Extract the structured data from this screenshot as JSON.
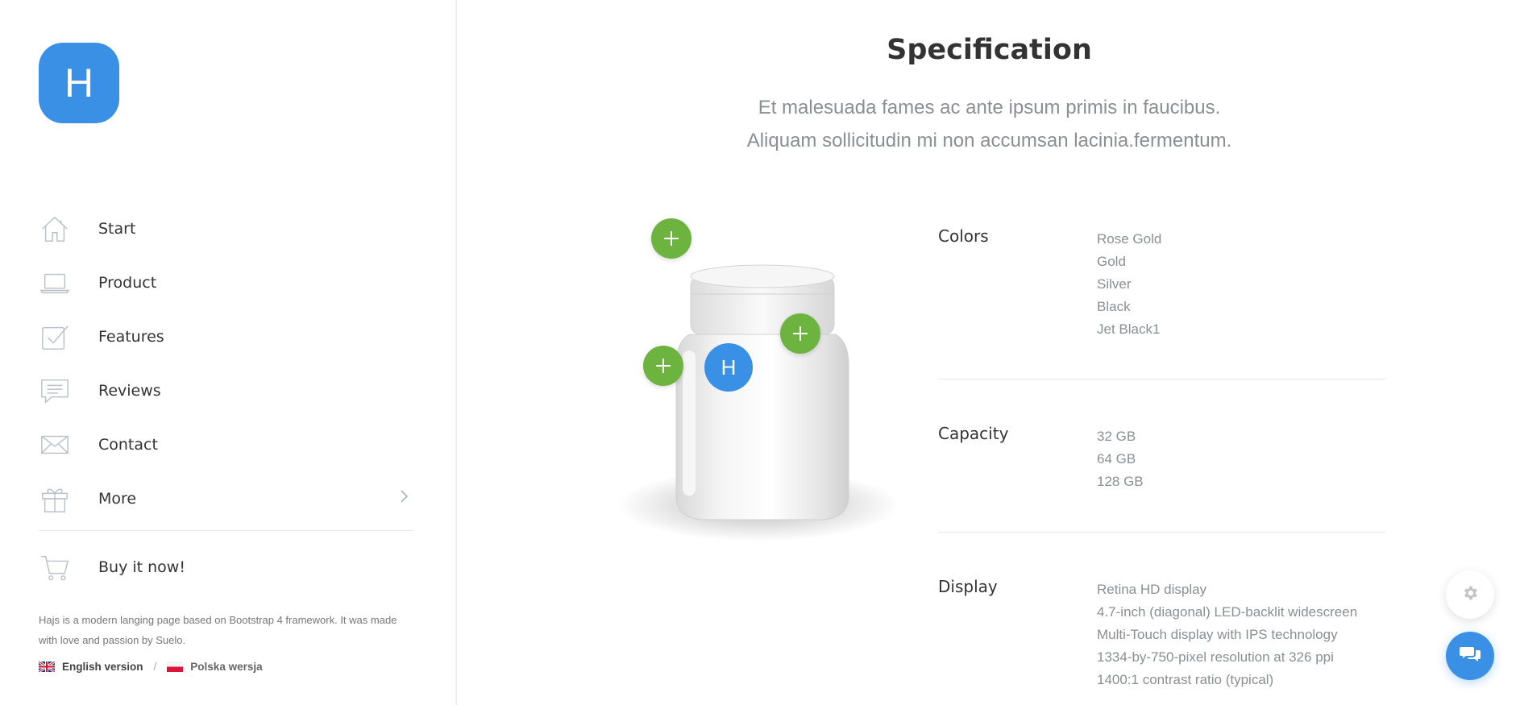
{
  "sidebar": {
    "logo_letter": "H",
    "nav": [
      {
        "label": "Start",
        "icon": "home-icon"
      },
      {
        "label": "Product",
        "icon": "laptop-icon"
      },
      {
        "label": "Features",
        "icon": "checkbox-icon"
      },
      {
        "label": "Reviews",
        "icon": "chat-bubble-icon"
      },
      {
        "label": "Contact",
        "icon": "envelope-icon"
      },
      {
        "label": "More",
        "icon": "gift-icon"
      }
    ],
    "buy_label": "Buy it now!",
    "footer_text": "Hajs is a modern langing page based on Bootstrap 4 framework. It was made with love and passion by Suelo.",
    "lang_en": "English version",
    "lang_separator": "/",
    "lang_pl": "Polska wersja"
  },
  "main": {
    "title": "Specification",
    "subtitle_line1": "Et malesuada fames ac ante ipsum primis in faucibus.",
    "subtitle_line2": "Aliquam sollicitudin mi non accumsan lacinia.fermentum.",
    "product_badge": "H",
    "specs": [
      {
        "label": "Colors",
        "values": [
          "Rose Gold",
          "Gold",
          "Silver",
          "Black",
          "Jet Black1"
        ]
      },
      {
        "label": "Capacity",
        "values": [
          "32 GB",
          "64 GB",
          "128 GB"
        ]
      },
      {
        "label": "Display",
        "values": [
          "Retina HD display",
          "4.7-inch (diagonal) LED-backlit widescreen",
          "Multi-Touch display with IPS technology",
          "1334-by-750-pixel resolution at 326 ppi",
          "1400:1 contrast ratio (typical)"
        ]
      }
    ]
  },
  "colors": {
    "accent": "#3a90e5",
    "hotspot": "#6db33f",
    "muted": "#8a8f94"
  }
}
